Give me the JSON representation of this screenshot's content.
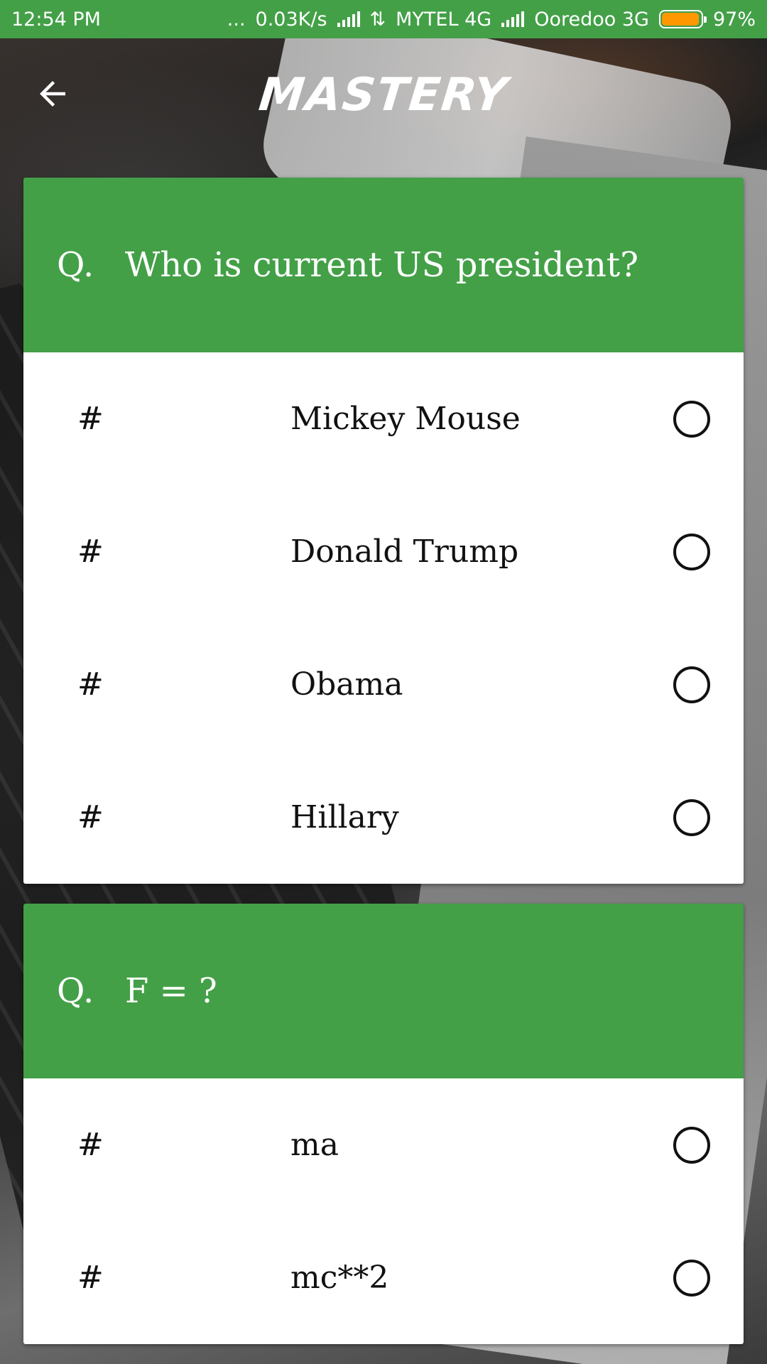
{
  "status_bar": {
    "time": "12:54 PM",
    "dots": "...",
    "speed": "0.03K/s",
    "carrier1": "MYTEL 4G",
    "carrier2": "Ooredoo 3G",
    "battery": "97%",
    "battery_level": 0.97,
    "color": "#43a047"
  },
  "app_bar": {
    "title": "MASTERY",
    "back_icon": "arrow-left-icon"
  },
  "questions": [
    {
      "prefix": "Q.",
      "text": "Who is current US president?",
      "options": [
        {
          "hash": "#",
          "text": "Mickey Mouse"
        },
        {
          "hash": "#",
          "text": "Donald Trump"
        },
        {
          "hash": "#",
          "text": "Obama"
        },
        {
          "hash": "#",
          "text": "Hillary"
        }
      ]
    },
    {
      "prefix": "Q.",
      "text": "F = ?",
      "options": [
        {
          "hash": "#",
          "text": "ma"
        },
        {
          "hash": "#",
          "text": "mc**2"
        }
      ]
    }
  ],
  "colors": {
    "accent": "#43a047",
    "card_bg": "#ffffff",
    "battery_fill": "#ff9800"
  }
}
